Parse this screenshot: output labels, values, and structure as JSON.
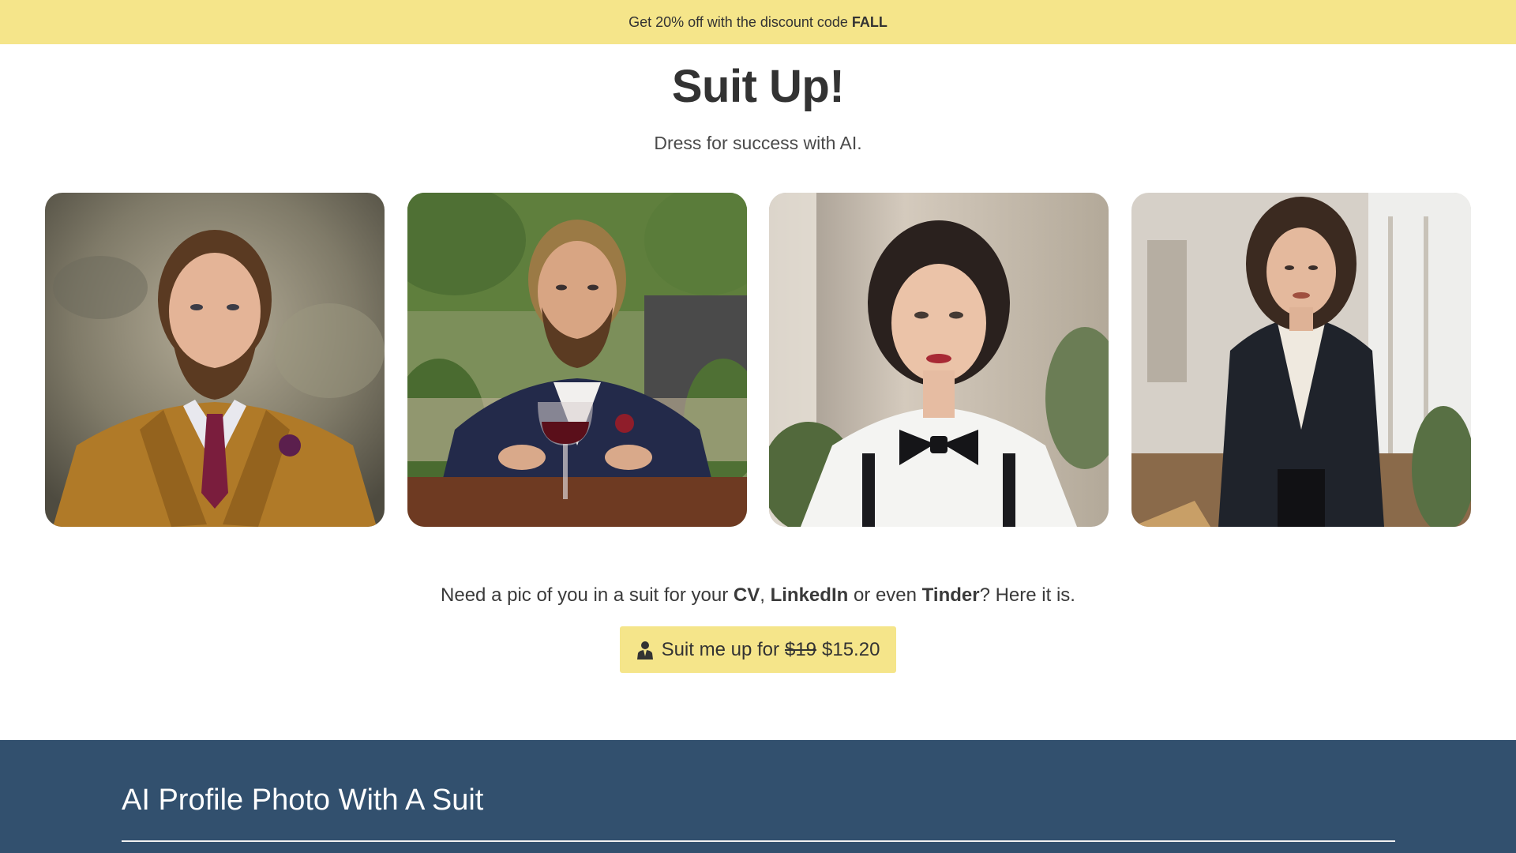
{
  "banner": {
    "text": "Get 20% off with the discount code",
    "code": "FALL"
  },
  "hero": {
    "title": "Suit Up!",
    "tagline": "Dress for success with AI."
  },
  "gallery": {
    "photos": [
      {
        "name": "man-mustard-suit-photo"
      },
      {
        "name": "man-navy-suit-wine-photo"
      },
      {
        "name": "woman-bow-tie-photo"
      },
      {
        "name": "woman-black-blazer-photo"
      }
    ]
  },
  "pitch": {
    "prefix": "Need a pic of you in a suit for your",
    "cv": "CV",
    "comma": ",",
    "linkedin": "LinkedIn",
    "middle": "or even",
    "tinder": "Tinder",
    "suffix": "? Here it is."
  },
  "cta": {
    "label": "Suit me up for",
    "old_price": "$19",
    "new_price": "$15.20",
    "icon": "person-suit-icon"
  },
  "footer": {
    "title": "AI Profile Photo With A Suit"
  },
  "colors": {
    "accent_yellow": "#f5e58a",
    "footer_blue": "#32506e"
  }
}
